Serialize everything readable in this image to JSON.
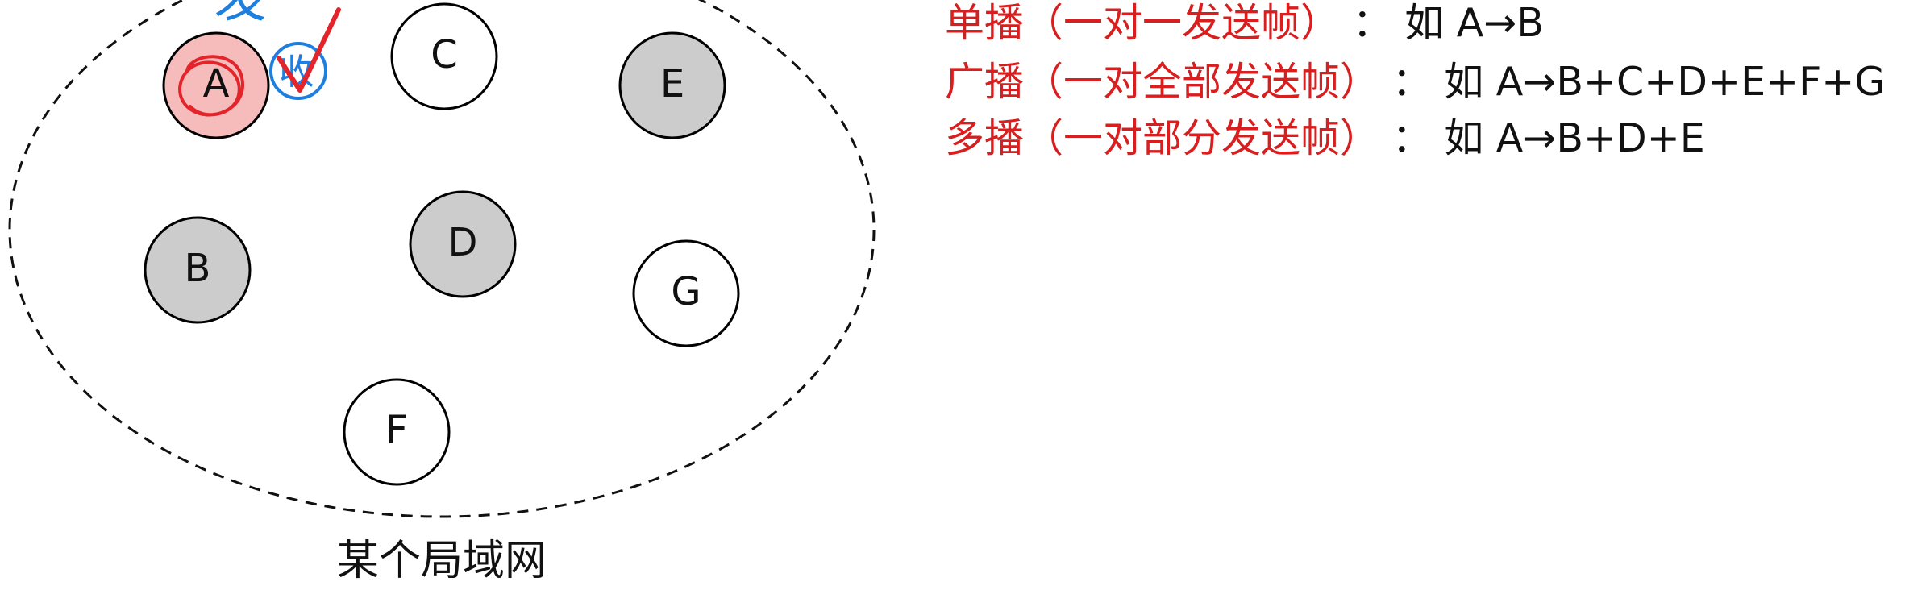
{
  "diagram": {
    "nodes": [
      {
        "id": "A",
        "label": "A",
        "shade": "highlight"
      },
      {
        "id": "B",
        "label": "B",
        "shade": "gray"
      },
      {
        "id": "C",
        "label": "C",
        "shade": "white"
      },
      {
        "id": "D",
        "label": "D",
        "shade": "gray"
      },
      {
        "id": "E",
        "label": "E",
        "shade": "gray"
      },
      {
        "id": "F",
        "label": "F",
        "shade": "white"
      },
      {
        "id": "G",
        "label": "G",
        "shade": "white"
      }
    ],
    "lan_label": "某个局域网",
    "annotations": {
      "handwritten_text": "发",
      "handwritten_circled_text": "收"
    }
  },
  "definitions": [
    {
      "term": "单播（一对一发送帧）",
      "sep": "：",
      "example": "如 A→B"
    },
    {
      "term": "广播（一对全部发送帧）",
      "sep": "：",
      "example": "如 A→B+C+D+E+F+G"
    },
    {
      "term": "多播（一对部分发送帧）",
      "sep": "：",
      "example": "如 A→B+D+E"
    }
  ],
  "colors": {
    "term": "#d81e1e",
    "text": "#111111",
    "node_stroke": "#000000",
    "gray_fill": "#cccccc",
    "white_fill": "#ffffff",
    "highlight_fill": "#f6bcbc",
    "red_ink": "#e4242b",
    "blue_ink": "#1e7fe0"
  }
}
